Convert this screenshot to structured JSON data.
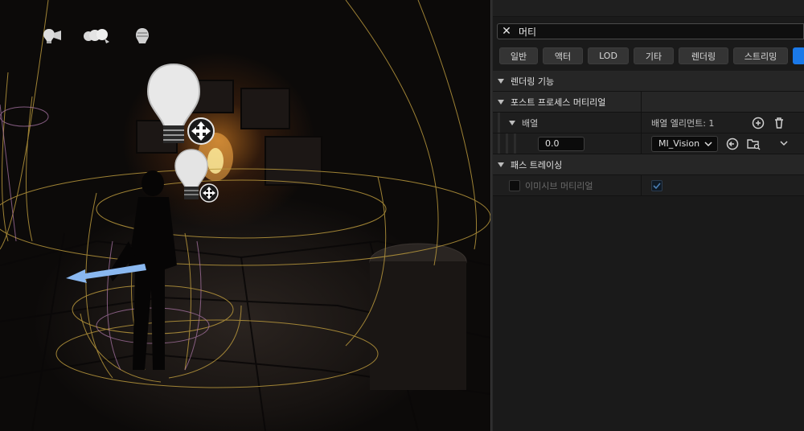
{
  "viewport": {
    "icons": [
      "point-light-icon",
      "spot-light-group-icon",
      "sky-light-icon"
    ]
  },
  "details": {
    "search": {
      "value": "머티"
    },
    "filters": [
      "일반",
      "액터",
      "LOD",
      "기타",
      "렌더링",
      "스트리밍"
    ],
    "categories": {
      "rendering_features": "렌더링 기능",
      "post_process_material": "포스트 프로세스 머티리얼",
      "array": "배열",
      "array_elements": "배열 엘리먼트: 1",
      "weight_value": "0.0",
      "material_value": "MI_Vision",
      "path_tracing": "패스 트레이싱",
      "emissive_material": "이미시브 머티리얼"
    },
    "colors": {
      "accent": "#1b79e8",
      "selection": "#1b79e8"
    }
  }
}
